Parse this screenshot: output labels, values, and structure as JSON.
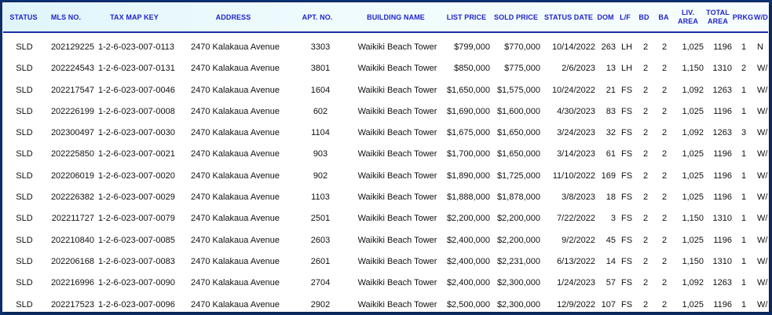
{
  "columns": {
    "status": "STATUS",
    "mls": "MLS NO.",
    "tmk": "TAX MAP KEY",
    "address": "ADDRESS",
    "apt": "APT. NO.",
    "building": "BUILDING NAME",
    "list": "LIST PRICE",
    "sold": "SOLD PRICE",
    "date": "STATUS DATE",
    "dom": "DOM",
    "lf": "L/F",
    "bd": "BD",
    "ba": "BA",
    "liv": "LIV.\nAREA",
    "total": "TOTAL\nAREA",
    "prkg": "PRKG",
    "wd": "W/D"
  },
  "rows": [
    {
      "status": "SLD",
      "mls": "202129225",
      "tmk": "1-2-6-023-007-0113",
      "address": "2470 Kalakaua Avenue",
      "apt": "3303",
      "building": "Waikiki Beach Tower",
      "list": "$799,000",
      "sold": "$770,000",
      "date": "10/14/2022",
      "dom": "263",
      "lf": "LH",
      "bd": "2",
      "ba": "2",
      "liv": "1,025",
      "total": "1196",
      "prkg": "1",
      "wd": "N"
    },
    {
      "status": "SLD",
      "mls": "202224543",
      "tmk": "1-2-6-023-007-0131",
      "address": "2470 Kalakaua Avenue",
      "apt": "3801",
      "building": "Waikiki Beach Tower",
      "list": "$850,000",
      "sold": "$775,000",
      "date": "2/6/2023",
      "dom": "13",
      "lf": "LH",
      "bd": "2",
      "ba": "2",
      "liv": "1,150",
      "total": "1310",
      "prkg": "2",
      "wd": "W/D"
    },
    {
      "status": "SLD",
      "mls": "202217547",
      "tmk": "1-2-6-023-007-0046",
      "address": "2470 Kalakaua Avenue",
      "apt": "1604",
      "building": "Waikiki Beach Tower",
      "list": "$1,650,000",
      "sold": "$1,575,000",
      "date": "10/24/2022",
      "dom": "21",
      "lf": "FS",
      "bd": "2",
      "ba": "2",
      "liv": "1,092",
      "total": "1263",
      "prkg": "1",
      "wd": "W/D"
    },
    {
      "status": "SLD",
      "mls": "202226199",
      "tmk": "1-2-6-023-007-0008",
      "address": "2470 Kalakaua Avenue",
      "apt": "602",
      "building": "Waikiki Beach Tower",
      "list": "$1,690,000",
      "sold": "$1,600,000",
      "date": "4/30/2023",
      "dom": "83",
      "lf": "FS",
      "bd": "2",
      "ba": "2",
      "liv": "1,025",
      "total": "1196",
      "prkg": "1",
      "wd": "W/D"
    },
    {
      "status": "SLD",
      "mls": "202300497",
      "tmk": "1-2-6-023-007-0030",
      "address": "2470 Kalakaua Avenue",
      "apt": "1104",
      "building": "Waikiki Beach Tower",
      "list": "$1,675,000",
      "sold": "$1,650,000",
      "date": "3/24/2023",
      "dom": "32",
      "lf": "FS",
      "bd": "2",
      "ba": "2",
      "liv": "1,092",
      "total": "1263",
      "prkg": "3",
      "wd": "W/D"
    },
    {
      "status": "SLD",
      "mls": "202225850",
      "tmk": "1-2-6-023-007-0021",
      "address": "2470 Kalakaua Avenue",
      "apt": "903",
      "building": "Waikiki Beach Tower",
      "list": "$1,700,000",
      "sold": "$1,650,000",
      "date": "3/14/2023",
      "dom": "61",
      "lf": "FS",
      "bd": "2",
      "ba": "2",
      "liv": "1,025",
      "total": "1196",
      "prkg": "1",
      "wd": "W/D"
    },
    {
      "status": "SLD",
      "mls": "202206019",
      "tmk": "1-2-6-023-007-0020",
      "address": "2470 Kalakaua Avenue",
      "apt": "902",
      "building": "Waikiki Beach Tower",
      "list": "$1,890,000",
      "sold": "$1,725,000",
      "date": "11/10/2022",
      "dom": "169",
      "lf": "FS",
      "bd": "2",
      "ba": "2",
      "liv": "1,025",
      "total": "1196",
      "prkg": "1",
      "wd": "W/D"
    },
    {
      "status": "SLD",
      "mls": "202226382",
      "tmk": "1-2-6-023-007-0029",
      "address": "2470 Kalakaua Avenue",
      "apt": "1103",
      "building": "Waikiki Beach Tower",
      "list": "$1,888,000",
      "sold": "$1,878,000",
      "date": "3/8/2023",
      "dom": "18",
      "lf": "FS",
      "bd": "2",
      "ba": "2",
      "liv": "1,025",
      "total": "1196",
      "prkg": "1",
      "wd": "W/D"
    },
    {
      "status": "SLD",
      "mls": "202211727",
      "tmk": "1-2-6-023-007-0079",
      "address": "2470 Kalakaua Avenue",
      "apt": "2501",
      "building": "Waikiki Beach Tower",
      "list": "$2,200,000",
      "sold": "$2,200,000",
      "date": "7/22/2022",
      "dom": "3",
      "lf": "FS",
      "bd": "2",
      "ba": "2",
      "liv": "1,150",
      "total": "1310",
      "prkg": "1",
      "wd": "W/D"
    },
    {
      "status": "SLD",
      "mls": "202210840",
      "tmk": "1-2-6-023-007-0085",
      "address": "2470 Kalakaua Avenue",
      "apt": "2603",
      "building": "Waikiki Beach Tower",
      "list": "$2,400,000",
      "sold": "$2,200,000",
      "date": "9/2/2022",
      "dom": "45",
      "lf": "FS",
      "bd": "2",
      "ba": "2",
      "liv": "1,025",
      "total": "1196",
      "prkg": "1",
      "wd": "W/D"
    },
    {
      "status": "SLD",
      "mls": "202206168",
      "tmk": "1-2-6-023-007-0083",
      "address": "2470 Kalakaua Avenue",
      "apt": "2601",
      "building": "Waikiki Beach Tower",
      "list": "$2,400,000",
      "sold": "$2,231,000",
      "date": "6/13/2022",
      "dom": "14",
      "lf": "FS",
      "bd": "2",
      "ba": "2",
      "liv": "1,150",
      "total": "1310",
      "prkg": "1",
      "wd": "W/D"
    },
    {
      "status": "SLD",
      "mls": "202216996",
      "tmk": "1-2-6-023-007-0090",
      "address": "2470 Kalakaua Avenue",
      "apt": "2704",
      "building": "Waikiki Beach Tower",
      "list": "$2,400,000",
      "sold": "$2,300,000",
      "date": "1/24/2023",
      "dom": "57",
      "lf": "FS",
      "bd": "2",
      "ba": "2",
      "liv": "1,092",
      "total": "1263",
      "prkg": "1",
      "wd": "W/D"
    },
    {
      "status": "SLD",
      "mls": "202217523",
      "tmk": "1-2-6-023-007-0096",
      "address": "2470 Kalakaua Avenue",
      "apt": "2902",
      "building": "Waikiki Beach Tower",
      "list": "$2,500,000",
      "sold": "$2,300,000",
      "date": "12/9/2022",
      "dom": "107",
      "lf": "FS",
      "bd": "2",
      "ba": "2",
      "liv": "1,025",
      "total": "1196",
      "prkg": "1",
      "wd": "W/D"
    }
  ]
}
